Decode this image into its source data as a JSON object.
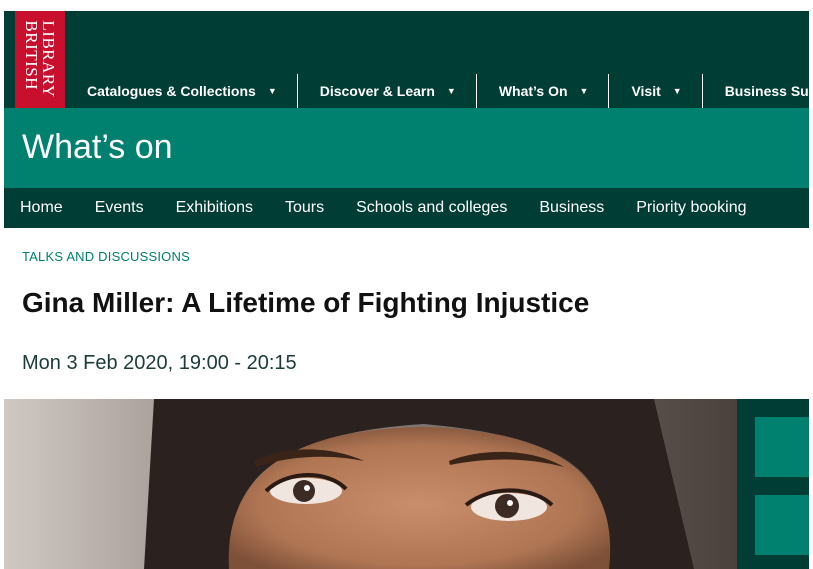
{
  "logo": {
    "line1": "BRITISH",
    "line2": "LIBRARY"
  },
  "main_nav": [
    {
      "label": "Catalogues & Collections"
    },
    {
      "label": "Discover & Learn"
    },
    {
      "label": "What’s On"
    },
    {
      "label": "Visit"
    },
    {
      "label": "Business Supp"
    }
  ],
  "section_title": "What’s on",
  "sub_nav": [
    "Home",
    "Events",
    "Exhibitions",
    "Tours",
    "Schools and colleges",
    "Business",
    "Priority booking"
  ],
  "event": {
    "category": "TALKS AND DISCUSSIONS",
    "title": "Gina Miller: A Lifetime of Fighting Injustice",
    "datetime": "Mon 3 Feb 2020, 19:00 - 20:15"
  },
  "icons": {
    "dropdown": "chevron-down-icon"
  },
  "colors": {
    "dark_green": "#003d35",
    "teal": "#00806e",
    "brand_red": "#c8102e"
  }
}
